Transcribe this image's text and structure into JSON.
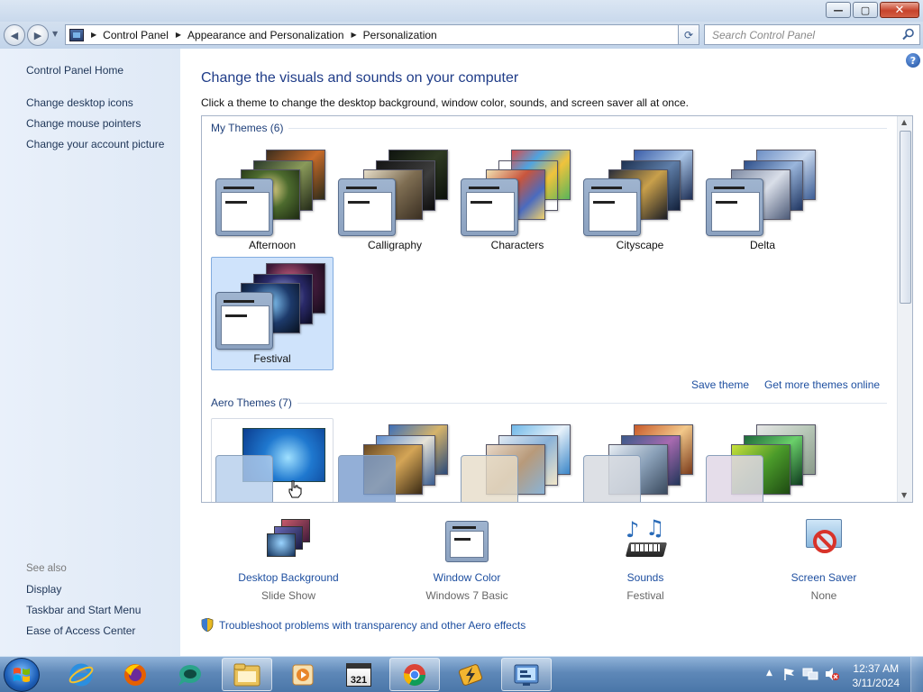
{
  "window": {
    "minimize": "—",
    "maximize": "▢",
    "close": "✕"
  },
  "nav": {
    "back_icon": "back-arrow-icon",
    "forward_icon": "forward-arrow-icon"
  },
  "address": {
    "crumbs": [
      "Control Panel",
      "Appearance and Personalization",
      "Personalization"
    ]
  },
  "search": {
    "placeholder": "Search Control Panel"
  },
  "sidebar": {
    "home": "Control Panel Home",
    "links": [
      "Change desktop icons",
      "Change mouse pointers",
      "Change your account picture"
    ],
    "see_also_title": "See also",
    "see_also": [
      "Display",
      "Taskbar and Start Menu",
      "Ease of Access Center"
    ]
  },
  "main": {
    "title": "Change the visuals and sounds on your computer",
    "subtitle": "Click a theme to change the desktop background, window color, sounds, and screen saver all at once."
  },
  "themes": {
    "my_themes_title": "My Themes (6)",
    "my_themes": [
      "Afternoon",
      "Calligraphy",
      "Characters",
      "Cityscape",
      "Delta",
      "Festival"
    ],
    "selected": "Festival",
    "save_theme": "Save theme",
    "get_more": "Get more themes online",
    "aero_title": "Aero Themes (7)"
  },
  "bottom": {
    "desktop_background": {
      "label": "Desktop Background",
      "value": "Slide Show"
    },
    "window_color": {
      "label": "Window Color",
      "value": "Windows 7 Basic"
    },
    "sounds": {
      "label": "Sounds",
      "value": "Festival"
    },
    "screen_saver": {
      "label": "Screen Saver",
      "value": "None"
    }
  },
  "troubleshoot": "Troubleshoot problems with transparency and other Aero effects",
  "taskbar": {
    "time": "12:37 AM",
    "date": "3/11/2024",
    "calendar_icon_text": "321"
  },
  "colors": {
    "link": "#1e4fa0",
    "title": "#1f3c88",
    "selection": "#cfe3fb"
  }
}
